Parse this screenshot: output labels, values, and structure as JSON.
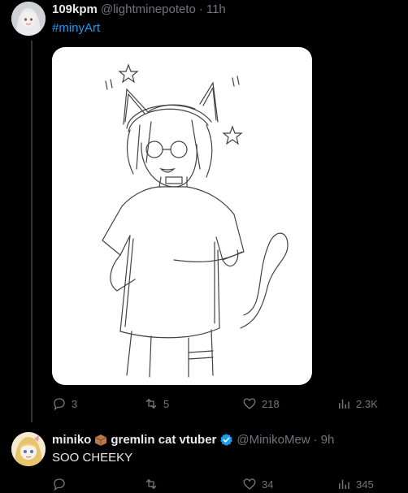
{
  "post": {
    "display_name": "109kpm",
    "handle": "@lightminepoteto",
    "time": "11h",
    "hashtag": "#minyArt",
    "stats": {
      "replies": "3",
      "reposts": "5",
      "likes": "218",
      "views": "2.3K"
    }
  },
  "reply": {
    "display_name": "miniko",
    "name_suffix": "gremlin cat vtuber",
    "handle": "@MinikoMew",
    "time": "9h",
    "text": "SOO CHEEKY",
    "stats": {
      "replies": "",
      "reposts": "",
      "likes": "34",
      "views": "345"
    }
  },
  "separator": "·",
  "colors": {
    "accent": "#1d9bf0",
    "muted": "#71767b",
    "text": "#e7e9ea",
    "bg": "#000000"
  }
}
